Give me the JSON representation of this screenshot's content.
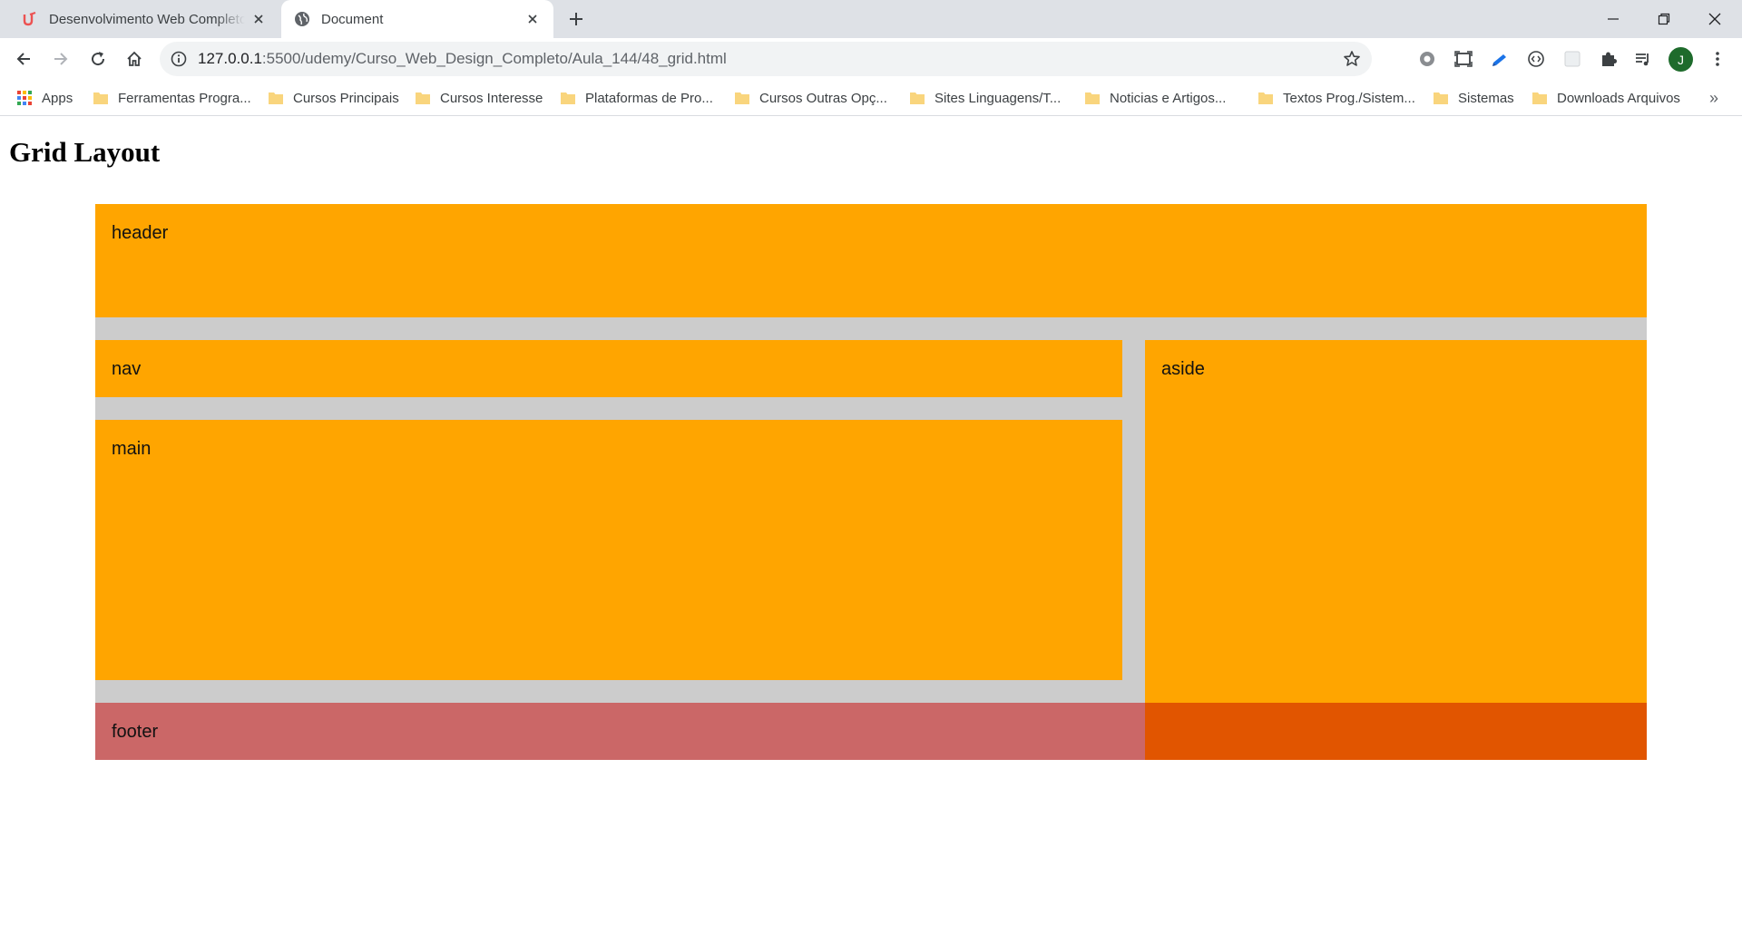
{
  "browser": {
    "tabs": [
      {
        "title": "Desenvolvimento Web Completo",
        "active": false,
        "favicon": "udemy-icon"
      },
      {
        "title": "Document",
        "active": true,
        "favicon": "globe-icon"
      }
    ],
    "address": {
      "host": "127.0.0.1",
      "path": ":5500/udemy/Curso_Web_Design_Completo/Aula_144/48_grid.html"
    },
    "avatar_letter": "J",
    "bookmarks": [
      "Apps",
      "Ferramentas Progra...",
      "Cursos Principais",
      "Cursos Interesse",
      "Plataformas de Pro...",
      "Cursos Outras Opç...",
      "Sites Linguagens/T...",
      "Noticias e Artigos...",
      "Textos Prog./Sistem...",
      "Sistemas",
      "Downloads Arquivos"
    ],
    "bookmarks_overflow": "»"
  },
  "page": {
    "title": "Grid Layout",
    "cells": {
      "header": "header",
      "nav": "nav",
      "main": "main",
      "aside": "aside",
      "footer": "footer"
    }
  },
  "colors": {
    "block": "#ffa500",
    "gap": "#cccccc",
    "footer": "#cb6767",
    "corner": "#e15500"
  }
}
